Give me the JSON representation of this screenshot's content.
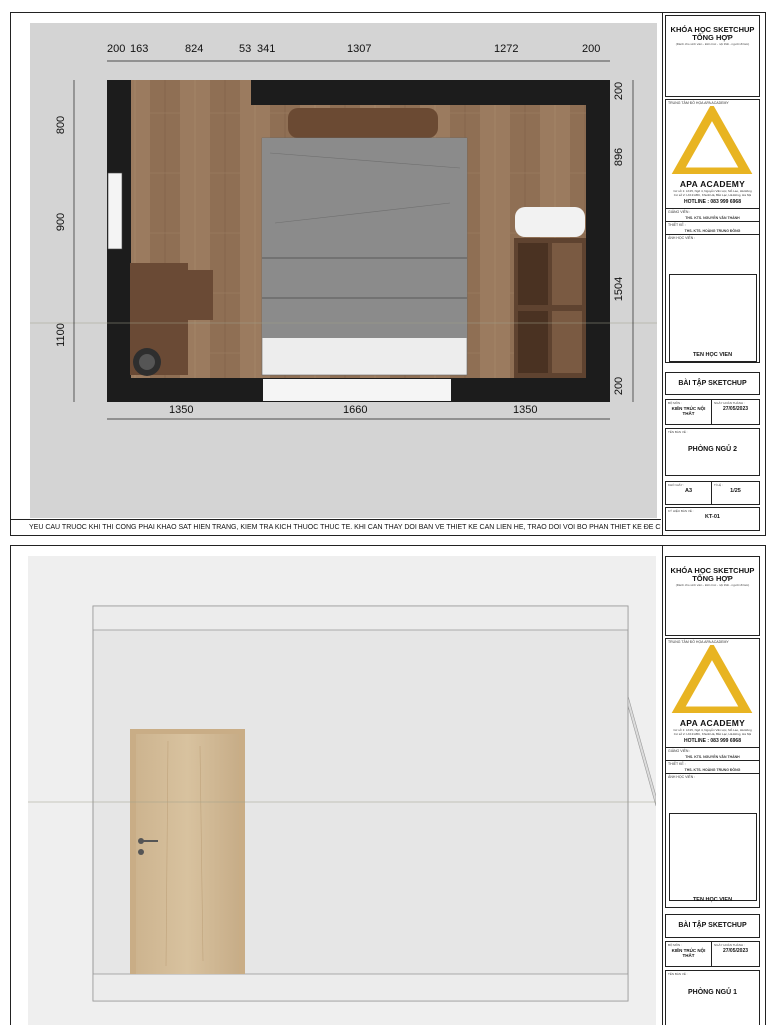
{
  "sheet1": {
    "note": "YEU CAU TRUOC KHI THI CONG PHAI KHAO SAT HIEN TRANG, KIEM TRA KICH THUOC THUC TE. KHI CAN THAY DOI BAN VE THIET KE CAN LIEN HE, TRAO DOI VOI BO PHAN THIET KE ĐE CHINH SUA",
    "dims_top": [
      "200",
      "163",
      "824",
      "53",
      "341",
      "1307",
      "1272",
      "200"
    ],
    "dims_bottom": [
      "1350",
      "1660",
      "1350"
    ],
    "dims_left": [
      "800",
      "900",
      "1100"
    ],
    "dims_right": [
      "200",
      "896",
      "1504",
      "200"
    ],
    "title_block": {
      "course_title": "KHÓA HỌC SKETCHUP TỔNG HỢP",
      "course_sub": "(Dành cho sinh viên - kiến trúc - nội thất - người đi làm)",
      "center_label": "TRUNG TÂM ĐỒ HỌA APA ACADEMY",
      "logo_name": "APA ACADEMY",
      "address1": "Cơ sở 1: LK15, Ngõ 4, Nguyễn Văn Lộc, Mỗ Lao, Hà Đông",
      "address2": "Cơ sở 2: LK19 ABC, Khuất Hà, Bắc Lạc, Hà Đông, Hà Nội",
      "hotline": "HOTLINE : 083 999 6968",
      "teacher_label": "GIẢNG VIÊN :",
      "teacher": "THS. KTS. NGUYỄN VĂN THÀNH",
      "reviewer_label": "THIẾT KẾ :",
      "reviewer": "THS. KTS. HOÀNG TRUNG ĐÔNG",
      "photo_label": "ẢNH HỌC VIÊN :",
      "student": "TEN HỌC VIEN",
      "assignment": "BÀI TẬP SKETCHUP",
      "subject_label": "BỘ MÔN :",
      "subject": "KIẾN TRÚC NỘI THẤT",
      "date_label": "NGÀY HOÀN THÀNH :",
      "date": "27/05/2023",
      "drawing_label": "TÊN BẢN VẼ :",
      "drawing_name": "PHÒNG NGỦ 2",
      "paper_label": "KHỔ GIẤY :",
      "paper": "A3",
      "scale_label": "TỈ LỆ :",
      "scale": "1/25",
      "sheet_label": "KÝ HIỆU BẢN VẼ :",
      "sheet_no": "KT-01"
    }
  },
  "sheet2": {
    "title_block": {
      "course_title": "KHÓA HỌC SKETCHUP TỔNG HỢP",
      "course_sub": "(Dành cho sinh viên - kiến trúc - nội thất - người đi làm)",
      "center_label": "TRUNG TÂM ĐỒ HỌA APA ACADEMY",
      "logo_name": "APA ACADEMY",
      "address1": "Cơ sở 1: LK15, Ngõ 4, Nguyễn Văn Lộc, Mỗ Lao, Hà Đông",
      "address2": "Cơ sở 2: LK19 ABC, Khuất Hà, Bắc Lạc, Hà Đông, Hà Nội",
      "hotline": "HOTLINE : 083 999 6968",
      "teacher_label": "GIẢNG VIÊN :",
      "teacher": "THS. KTS. NGUYỄN VĂN THÀNH",
      "reviewer_label": "THIẾT KẾ :",
      "reviewer": "THS. KTS. HOÀNG TRUNG ĐÔNG",
      "photo_label": "ẢNH HỌC VIÊN :",
      "student": "TEN HỌC VIEN",
      "assignment": "BÀI TẬP SKETCHUP",
      "subject_label": "BỘ MÔN :",
      "subject": "KIẾN TRÚC NỘI THẤT",
      "date_label": "NGÀY HOÀN THÀNH :",
      "date": "27/05/2023",
      "drawing_label": "TÊN BẢN VẼ :",
      "drawing_name": "PHÒNG NGỦ 1"
    }
  },
  "colors": {
    "logo_yellow": "#e8b422",
    "wall": "#1c1c1c",
    "wood": "#9a7a5e",
    "bed_gray": "#8b8b8b"
  }
}
